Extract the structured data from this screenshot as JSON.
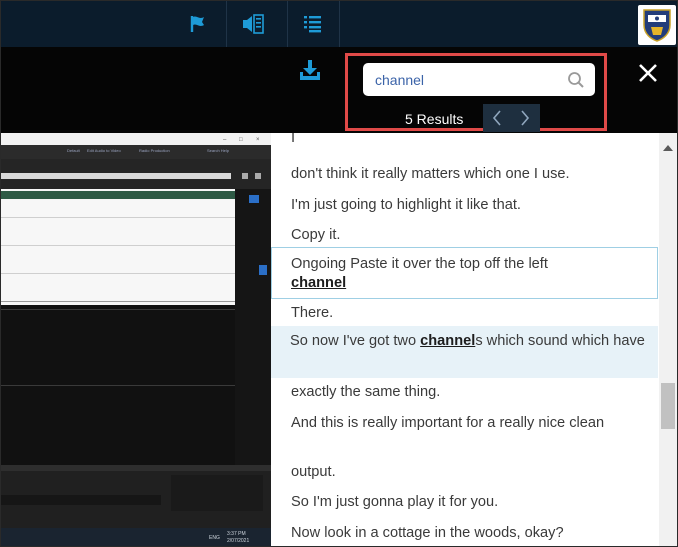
{
  "topbar": {
    "icons": [
      "flag-icon",
      "audio-description-icon",
      "transcript-list-icon"
    ],
    "logo": "university-crest-logo",
    "colors": {
      "background": "#0b1c2c",
      "icon": "#1e9bd7"
    }
  },
  "search": {
    "value": "channel",
    "placeholder": "",
    "results_text": "5 Results",
    "prev_label": "‹",
    "next_label": "›",
    "highlight_color": "#e04a48"
  },
  "video": {
    "menu_items": [
      "Default",
      "Edit Audio to Video",
      "Radio Production",
      "Search Help"
    ],
    "taskbar": {
      "language": "ENG",
      "time": "3:37 PM",
      "date": "2/07/2021"
    }
  },
  "transcript": {
    "partial_top": "I",
    "lines": {
      "l1": "don't think it really matters which one I use.",
      "l2": "I'm just going to highlight it like that.",
      "l3": "Copy it.",
      "l4_prefix": "Ongoing Paste it over the top off the left",
      "l4_match": "channel",
      "l5": "There.",
      "l6_prefix": "So now I've got two ",
      "l6_match": "channel",
      "l6_suffix": "s which sound which have",
      "l7": "exactly the same thing.",
      "l8": "And this is really important for a really nice clean",
      "l9": "output.",
      "l10": "So I'm just gonna play it for you.",
      "l11": "Now look in a cottage in the woods, okay?"
    }
  }
}
